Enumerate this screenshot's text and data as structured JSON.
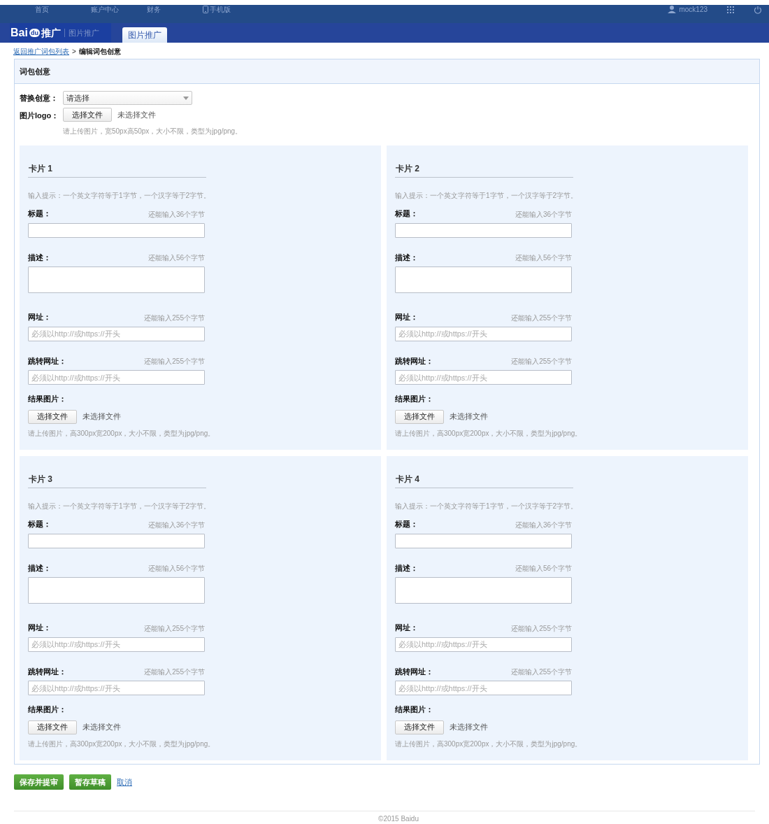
{
  "top_nav": {
    "links": [
      {
        "label": "首页",
        "kind": "text"
      },
      {
        "label": "账户中心",
        "kind": "text"
      },
      {
        "label": "财务",
        "kind": "text"
      },
      {
        "label": "手机版",
        "kind": "phone"
      }
    ],
    "user": "mock123"
  },
  "header": {
    "logo": {
      "brand": "Bai",
      "badge": "du",
      "product": "推广",
      "subtitle": "图片推广"
    },
    "tabs": [
      {
        "label": "图片推广",
        "selected": true
      }
    ]
  },
  "breadcrumb": {
    "link": "返回推广词包列表",
    "separator": ">",
    "current": "编辑词包创意"
  },
  "panel": {
    "title": "词包创意",
    "replace": {
      "label": "替换创意：",
      "value": "请选择"
    },
    "logo_upload": {
      "label": "图片logo：",
      "button": "选择文件",
      "status": "未选择文件",
      "hint": "请上传图片，宽50px高50px，大小不限，类型为jpg/png。"
    },
    "cards": [
      {
        "title": "卡片 1",
        "hint": "输入提示：一个英文字符等于1字节，一个汉字等于2字节。",
        "fields": [
          {
            "kind": "input",
            "label": "标题：",
            "counter": "还能输入36个字节"
          },
          {
            "kind": "textarea",
            "label": "描述：",
            "counter": "还能输入56个字节"
          },
          {
            "kind": "input",
            "label": "网址：",
            "counter": "还能输入255个字节",
            "placeholder": "必须以http://或https://开头"
          },
          {
            "kind": "input",
            "label": "跳转网址：",
            "counter": "还能输入255个字节",
            "placeholder": "必须以http://或https://开头"
          }
        ],
        "upload": {
          "label": "结果图片：",
          "button": "选择文件",
          "status": "未选择文件",
          "hint": "请上传图片，高300px宽200px，大小不限，类型为jpg/png。"
        }
      },
      {
        "title": "卡片 2",
        "hint": "输入提示：一个英文字符等于1字节，一个汉字等于2字节。",
        "fields": [
          {
            "kind": "input",
            "label": "标题：",
            "counter": "还能输入36个字节"
          },
          {
            "kind": "textarea",
            "label": "描述：",
            "counter": "还能输入56个字节"
          },
          {
            "kind": "input",
            "label": "网址：",
            "counter": "还能输入255个字节",
            "placeholder": "必须以http://或https://开头"
          },
          {
            "kind": "input",
            "label": "跳转网址：",
            "counter": "还能输入255个字节",
            "placeholder": "必须以http://或https://开头"
          }
        ],
        "upload": {
          "label": "结果图片：",
          "button": "选择文件",
          "status": "未选择文件",
          "hint": "请上传图片，高300px宽200px，大小不限，类型为jpg/png。"
        }
      },
      {
        "title": "卡片 3",
        "hint": "输入提示：一个英文字符等于1字节，一个汉字等于2字节。",
        "fields": [
          {
            "kind": "input",
            "label": "标题：",
            "counter": "还能输入36个字节"
          },
          {
            "kind": "textarea",
            "label": "描述：",
            "counter": "还能输入56个字节"
          },
          {
            "kind": "input",
            "label": "网址：",
            "counter": "还能输入255个字节",
            "placeholder": "必须以http://或https://开头"
          },
          {
            "kind": "input",
            "label": "跳转网址：",
            "counter": "还能输入255个字节",
            "placeholder": "必须以http://或https://开头"
          }
        ],
        "upload": {
          "label": "结果图片：",
          "button": "选择文件",
          "status": "未选择文件",
          "hint": "请上传图片，高300px宽200px，大小不限，类型为jpg/png。"
        }
      },
      {
        "title": "卡片 4",
        "hint": "输入提示：一个英文字符等于1字节，一个汉字等于2字节。",
        "fields": [
          {
            "kind": "input",
            "label": "标题：",
            "counter": "还能输入36个字节"
          },
          {
            "kind": "textarea",
            "label": "描述：",
            "counter": "还能输入56个字节"
          },
          {
            "kind": "input",
            "label": "网址：",
            "counter": "还能输入255个字节",
            "placeholder": "必须以http://或https://开头"
          },
          {
            "kind": "input",
            "label": "跳转网址：",
            "counter": "还能输入255个字节",
            "placeholder": "必须以http://或https://开头"
          }
        ],
        "upload": {
          "label": "结果图片：",
          "button": "选择文件",
          "status": "未选择文件",
          "hint": "请上传图片，高300px宽200px，大小不限，类型为jpg/png。"
        }
      }
    ]
  },
  "actions": [
    {
      "kind": "button",
      "label": "保存并提审"
    },
    {
      "kind": "button",
      "label": "暂存草稿"
    },
    {
      "kind": "link",
      "label": "取消"
    }
  ],
  "footer": "©2015 Baidu"
}
